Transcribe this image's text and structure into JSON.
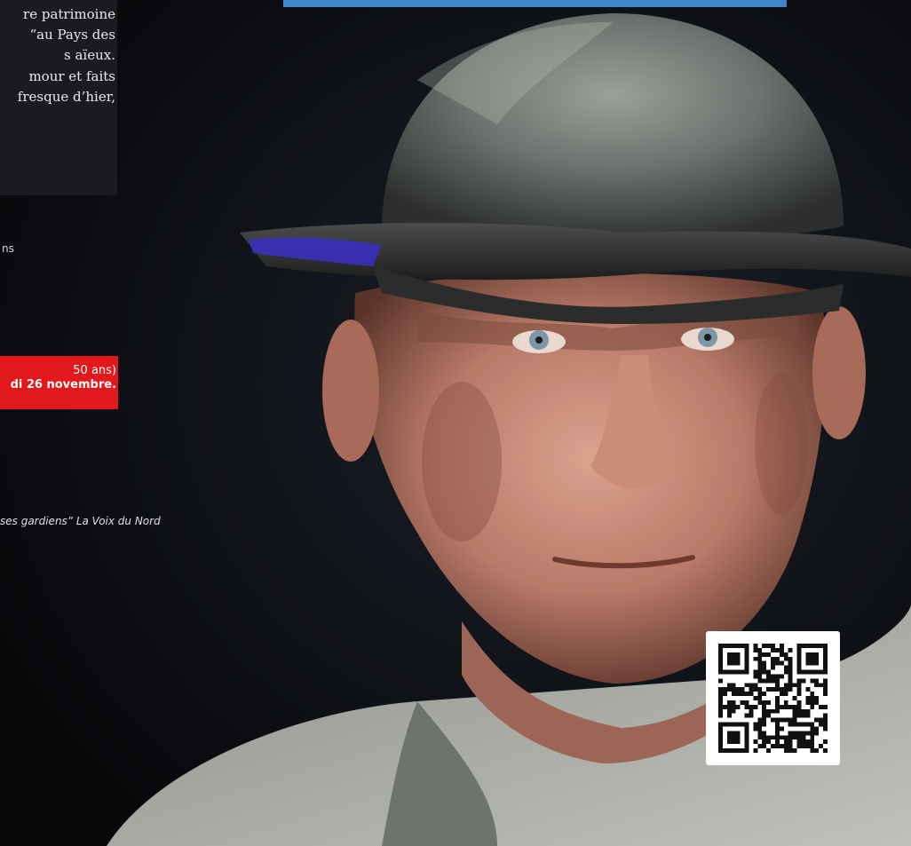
{
  "banner": {
    "color": "#3d86c8"
  },
  "intro_panel": {
    "lines": [
      "re patrimoine",
      "“au Pays des",
      "s aïeux.",
      "mour et faits",
      "fresque d’hier,"
    ]
  },
  "fragments": {
    "ans_word": "ns"
  },
  "notice": {
    "color": "#e3181c",
    "line1": "50 ans)",
    "line2": "di 26 novembre."
  },
  "quote": {
    "text": "ses gardiens” La Voix du Nord"
  },
  "photo": {
    "subject": "older man wearing a dented metal miner's helmet, portrait on dark background"
  },
  "qr": {
    "icon": "qr-code-icon"
  }
}
